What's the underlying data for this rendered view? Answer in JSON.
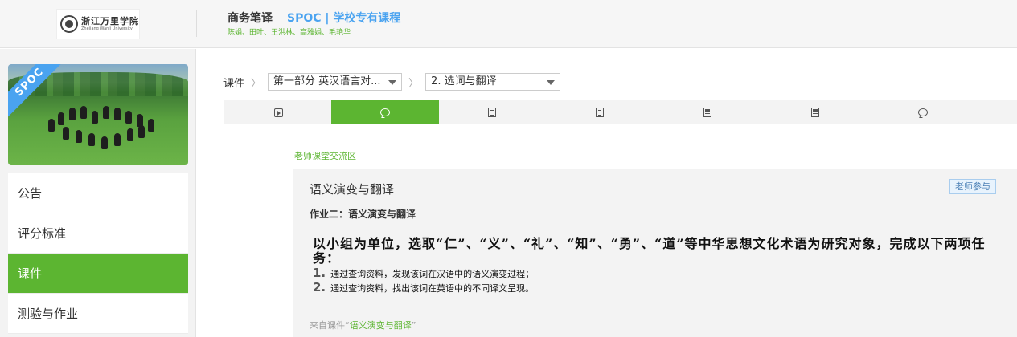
{
  "header": {
    "logo_cn": "浙江万里学院",
    "logo_en": "Zhejiang Wanli University",
    "course_title": "商务笔译",
    "course_tag": "SPOC | 学校专有课程",
    "teachers": "陈娟、田叶、王洪林、高雅娟、毛艳华"
  },
  "sidebar": {
    "cover_badge": "SPOC",
    "items": [
      {
        "label": "公告",
        "active": false
      },
      {
        "label": "评分标准",
        "active": false
      },
      {
        "label": "课件",
        "active": true
      },
      {
        "label": "测验与作业",
        "active": false
      }
    ]
  },
  "breadcrumb": {
    "root": "课件",
    "chapter_select": "第一部分 英汉语言对...",
    "lesson_select": "2. 选词与翻译"
  },
  "tabs": [
    {
      "icon": "video-icon",
      "active": false
    },
    {
      "icon": "discussion-icon",
      "active": true
    },
    {
      "icon": "document-icon",
      "active": false
    },
    {
      "icon": "document-icon",
      "active": false
    },
    {
      "icon": "test-icon",
      "active": false
    },
    {
      "icon": "test-icon",
      "active": false
    },
    {
      "icon": "discussion-icon",
      "active": false
    }
  ],
  "forum": {
    "section_label": "老师课堂交流区",
    "post_title": "语义演变与翻译",
    "badge": "老师参与",
    "subtitle": "作业二：语义演变与翻译",
    "task": "以小组为单位，选取“仁”、“义”、“礼”、“知”、“勇”、“道”等中华思想文化术语为研究对象，完成以下两项任务：",
    "steps": [
      {
        "num": "1.",
        "text": "通过查询资料，发现该词在汉语中的语义演变过程；"
      },
      {
        "num": "2.",
        "text": "通过查询资料，找出该词在英语中的不同译文呈现。"
      }
    ],
    "source_prefix": "来自课件“",
    "source_link": "语义演变与翻译",
    "source_suffix": "”"
  },
  "colors": {
    "accent_green": "#5cb531",
    "accent_blue": "#4aa3f0"
  }
}
